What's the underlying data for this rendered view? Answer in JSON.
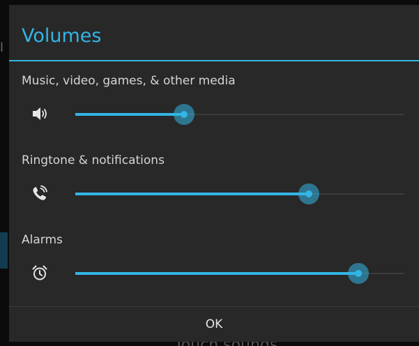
{
  "dialog": {
    "title": "Volumes",
    "accent_color": "#33b5e5",
    "sections": [
      {
        "label": "Music, video, games, & other media",
        "icon": "speaker-icon",
        "level": 0.33
      },
      {
        "label": "Ringtone & notifications",
        "icon": "phone-ring-icon",
        "level": 0.71
      },
      {
        "label": "Alarms",
        "icon": "alarm-clock-icon",
        "level": 0.86
      }
    ],
    "ok_label": "OK"
  },
  "background": {
    "partial_letter": "l",
    "partial_text": "Touch sounds"
  }
}
